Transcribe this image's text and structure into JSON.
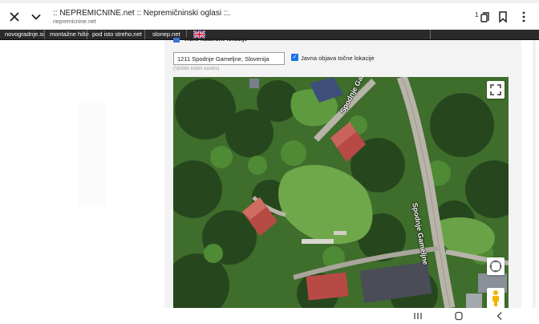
{
  "browser": {
    "title": ":: NEPREMICNINE.net :: Nepremičninski oglasi ::.",
    "host": "nepremicnine.net",
    "tab_count": "1"
  },
  "site_nav": {
    "links": [
      "novogradnje.si",
      "montažne hiše",
      "pod isto streho.net",
      "slonep.net"
    ]
  },
  "form": {
    "checkbox_top_label": "Vidne natančne lokacije",
    "address_value": "1211 Spodnje Gameljne, Slovenija",
    "address_hint": "(Vpišite točen naslov)",
    "public_location_label": "Javna objava točne lokacije",
    "public_location_checked": true
  },
  "map": {
    "road_label_north": "Spodnje Gameljne",
    "road_label_east": "Spodnje Gameljne"
  },
  "colors": {
    "accent": "#1a73e8",
    "nav_bg": "#2a2a2a",
    "road": "#b8b4aa",
    "roof": "#b84a45"
  },
  "icons": {
    "close": "close-icon",
    "back": "chevron-down-icon",
    "tabs": "tab-switcher-icon",
    "bookmark": "bookmark-icon",
    "more": "more-vertical-icon",
    "fullscreen": "fullscreen-icon",
    "pan": "pan-control-icon",
    "streetview": "pegman-icon"
  }
}
